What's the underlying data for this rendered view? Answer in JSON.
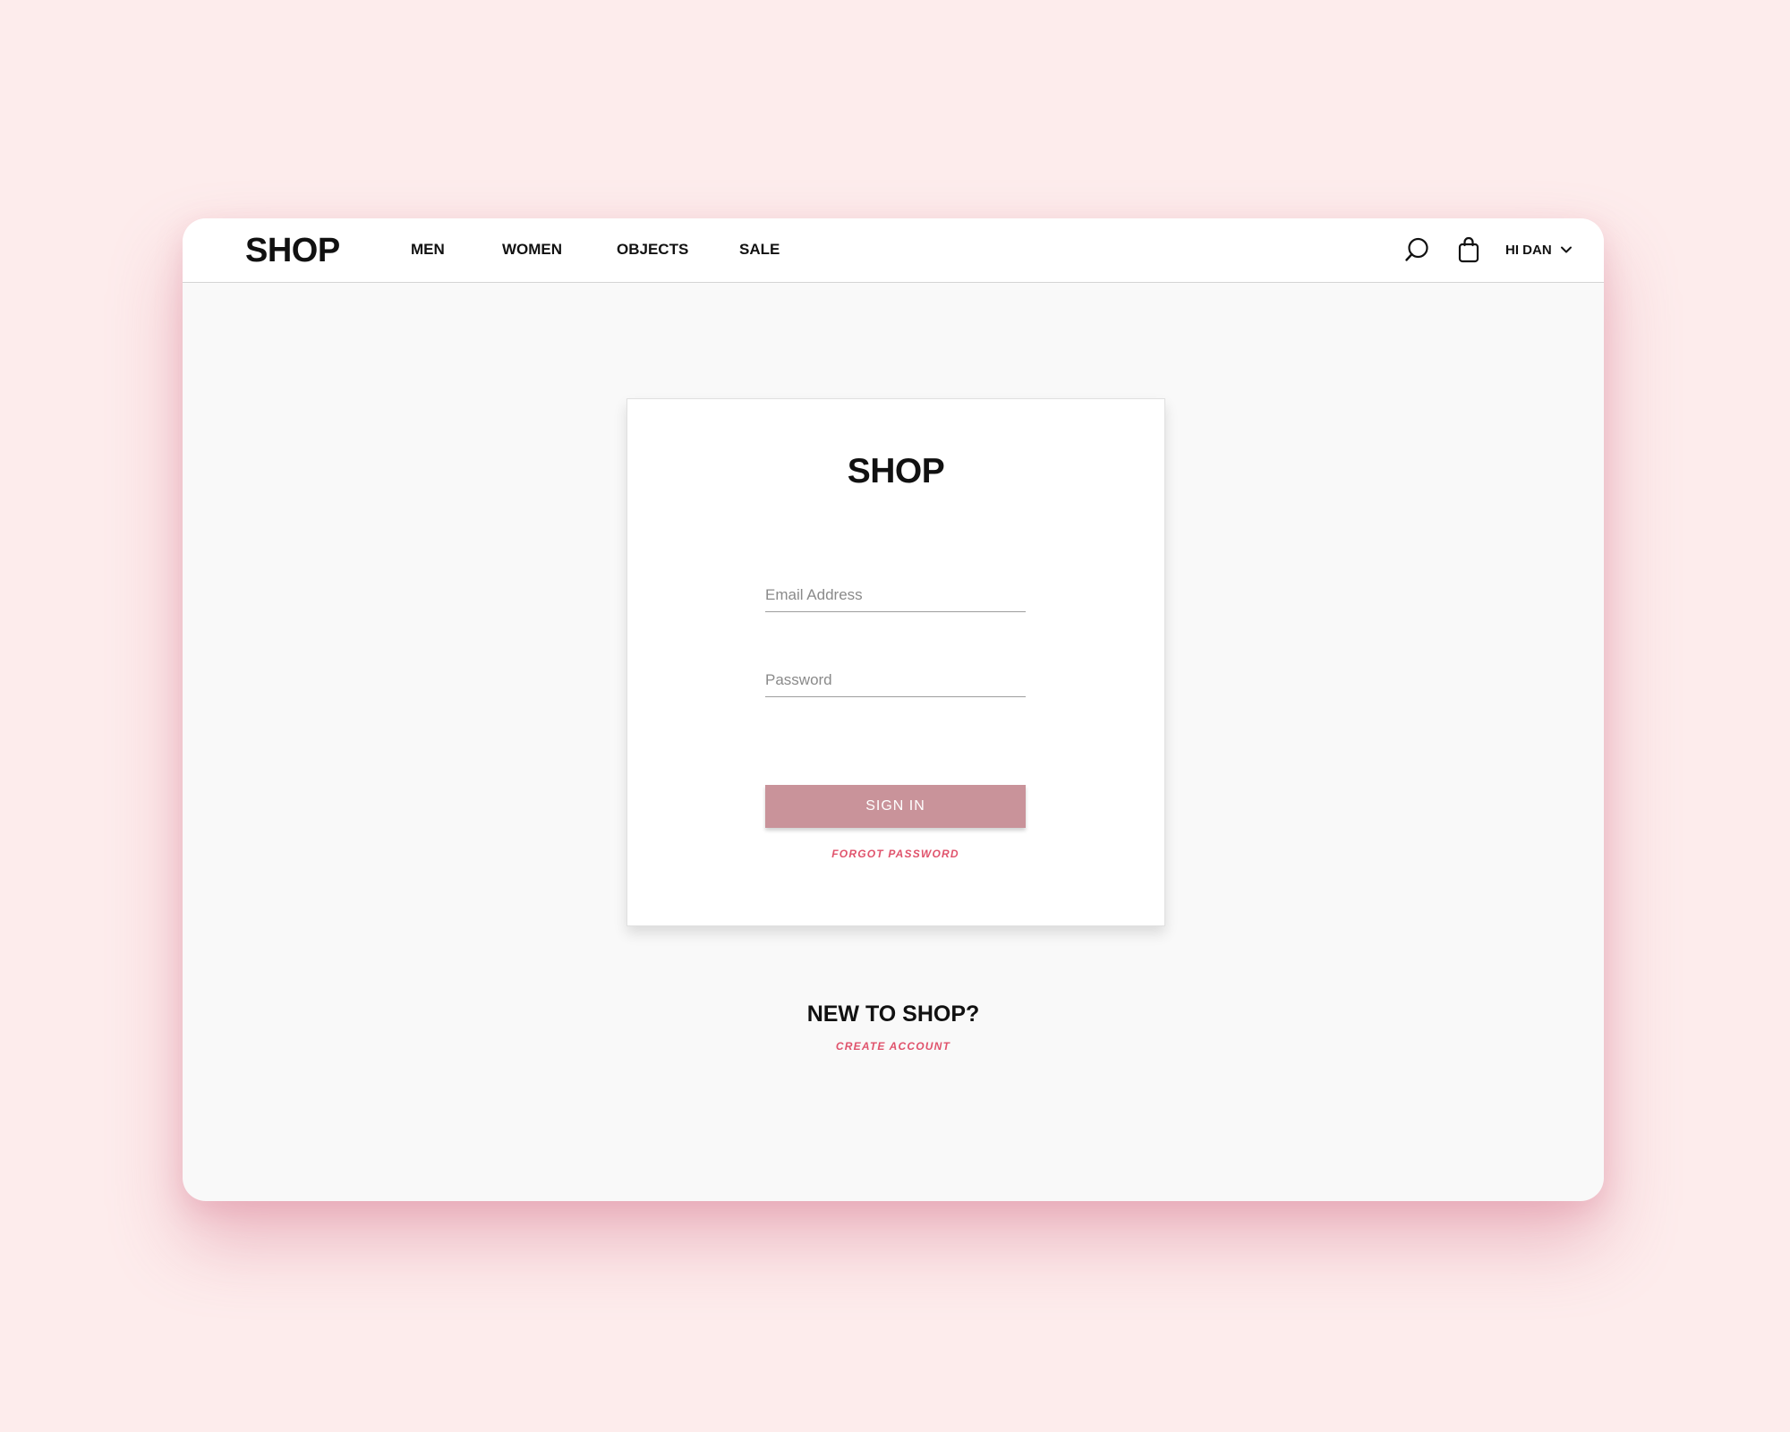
{
  "header": {
    "brand": "SHOP",
    "nav": [
      {
        "label": "MEN"
      },
      {
        "label": "WOMEN"
      },
      {
        "label": "OBJECTS"
      },
      {
        "label": "SALE"
      }
    ],
    "icons": {
      "search": "search-icon",
      "cart": "shopping-bag-icon",
      "caret": "chevron-down-icon"
    },
    "user_label": "HI DAN"
  },
  "login": {
    "title": "SHOP",
    "email": {
      "placeholder": "Email Address",
      "value": ""
    },
    "password": {
      "placeholder": "Password",
      "value": ""
    },
    "submit_label": "SIGN IN",
    "forgot_label": "FORGOT PASSWORD"
  },
  "signup": {
    "heading": "NEW TO SHOP?",
    "link_label": "CREATE ACCOUNT"
  },
  "colors": {
    "page_background": "#fdecec",
    "button": "#c9939a",
    "link": "#e0536c",
    "text": "#111111"
  }
}
